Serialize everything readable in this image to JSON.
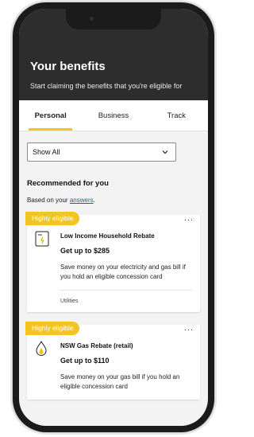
{
  "header": {
    "title": "Your benefits",
    "subtitle": "Start claiming the benefits that you're eligible for"
  },
  "tabs": [
    {
      "label": "Personal",
      "active": true
    },
    {
      "label": "Business",
      "active": false
    },
    {
      "label": "Track",
      "active": false
    }
  ],
  "filter": {
    "selected": "Show All"
  },
  "recommended": {
    "title": "Recommended for you",
    "based_on_prefix": "Based on your ",
    "based_on_link": "answers",
    "based_on_suffix": "."
  },
  "cards": [
    {
      "badge": "Highly eligible",
      "more": "...",
      "icon": "electricity-meter-icon",
      "title": "Low Income Household Rebate",
      "amount": "Get up to $285",
      "description": "Save money on your electricity and gas bill if you hold an eligible concession card",
      "category": "Utilities"
    },
    {
      "badge": "Highly eligible",
      "more": "...",
      "icon": "gas-flame-icon",
      "title": "NSW Gas Rebate (retail)",
      "amount": "Get up to $110",
      "description": "Save money on your gas bill if you hold an eligible concession card"
    }
  ],
  "colors": {
    "header_bg": "#2d2d2d",
    "accent": "#f2c522",
    "link": "#1f5fa8"
  }
}
